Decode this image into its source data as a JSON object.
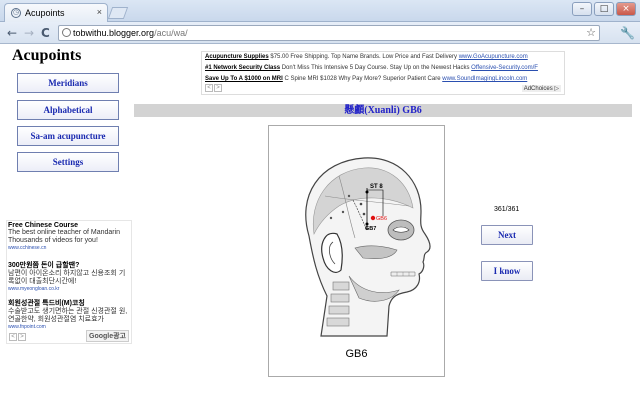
{
  "browser": {
    "tab_title": "Acupoints",
    "tab_close": "×",
    "new_tab": "+",
    "window_buttons": [
      "–",
      "□",
      "×"
    ],
    "back": "←",
    "forward": "→",
    "reload": "C",
    "url_host": "tobwithu.blogger.org",
    "url_path": "/acu/wa/",
    "star": "☆",
    "wrench": "🔧"
  },
  "site": {
    "title": "Acupoints",
    "menu": [
      {
        "label": "Meridians"
      },
      {
        "label": "Alphabetical"
      },
      {
        "label": "Sa-am acupuncture"
      },
      {
        "label": "Settings"
      }
    ]
  },
  "ad_left": {
    "items": [
      {
        "title": "Free Chinese Course",
        "desc": "The best online teacher of Mandarin Thousands of videos for you!",
        "url": "www.cchinese.cn"
      },
      {
        "title": "300만원쯤 돈이 급할땐?",
        "desc": "남편이 아이온소리 하지않고 신용조회 기록없이 대출최단시간에!",
        "url": "www.myeongloan.co.kr"
      },
      {
        "title": "회원성관절 특드비(M)코칭",
        "desc": "수술받고도 생기면하는 관절 신경관절 원, 연골한약, 회원성관절염 치료효가",
        "url": "www.fnpoint.com"
      }
    ],
    "nav_prev": "<",
    "nav_next": ">",
    "badge": "Google광고"
  },
  "ad_top": {
    "lines": [
      {
        "title": "Acupuncture Supplies",
        "desc": "$75.00 Free Shipping. Top Name Brands. Low Price and Fast Delivery",
        "url": "www.GoAcupuncture.com"
      },
      {
        "title": "#1 Network Security Class",
        "desc": "Don't Miss This Intensive 5 Day Course. Stay Up on the Newest Hacks",
        "url": "Offensive-Security.com/F"
      },
      {
        "title": "Save Up To A $1000 on MRI",
        "desc": "C Spine MRI $1028 Why Pay More? Superior Patient Care",
        "url": "www.SoundImagingLincoln.com"
      }
    ],
    "adchoices": "AdChoices ▷",
    "nav_prev": "<",
    "nav_next": ">"
  },
  "point": {
    "banner": "懸顱(Xuanli) GB6",
    "caption": "GB6",
    "labels": {
      "st8": "ST 8",
      "gb6": "GB6",
      "gb7": "GB7"
    }
  },
  "quiz": {
    "counter": "361/361",
    "next_label": "Next",
    "know_label": "I know"
  }
}
